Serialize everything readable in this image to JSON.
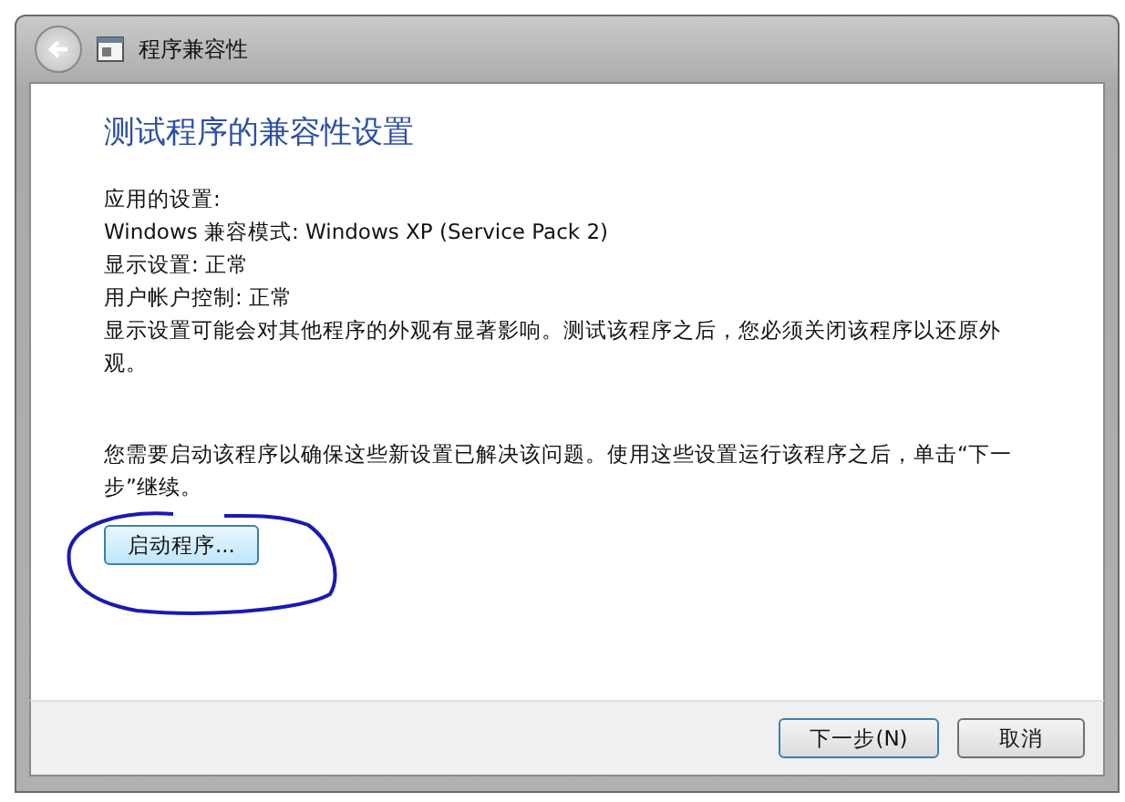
{
  "window": {
    "title": "程序兼容性"
  },
  "heading": "测试程序的兼容性设置",
  "settings_lines": [
    "应用的设置:",
    "Windows 兼容模式: Windows XP (Service Pack 2)",
    "显示设置:  正常",
    "用户帐户控制:  正常"
  ],
  "warning": "显示设置可能会对其他程序的外观有显著影响。测试该程序之后，您必须关闭该程序以还原外观。",
  "instruction": "您需要启动该程序以确保这些新设置已解决该问题。使用这些设置运行该程序之后，单击“下一步”继续。",
  "start_button": "启动程序...",
  "buttons": [
    {
      "label": "下一步(N)",
      "kind": "default"
    },
    {
      "label": "取消",
      "kind": "normal"
    }
  ]
}
